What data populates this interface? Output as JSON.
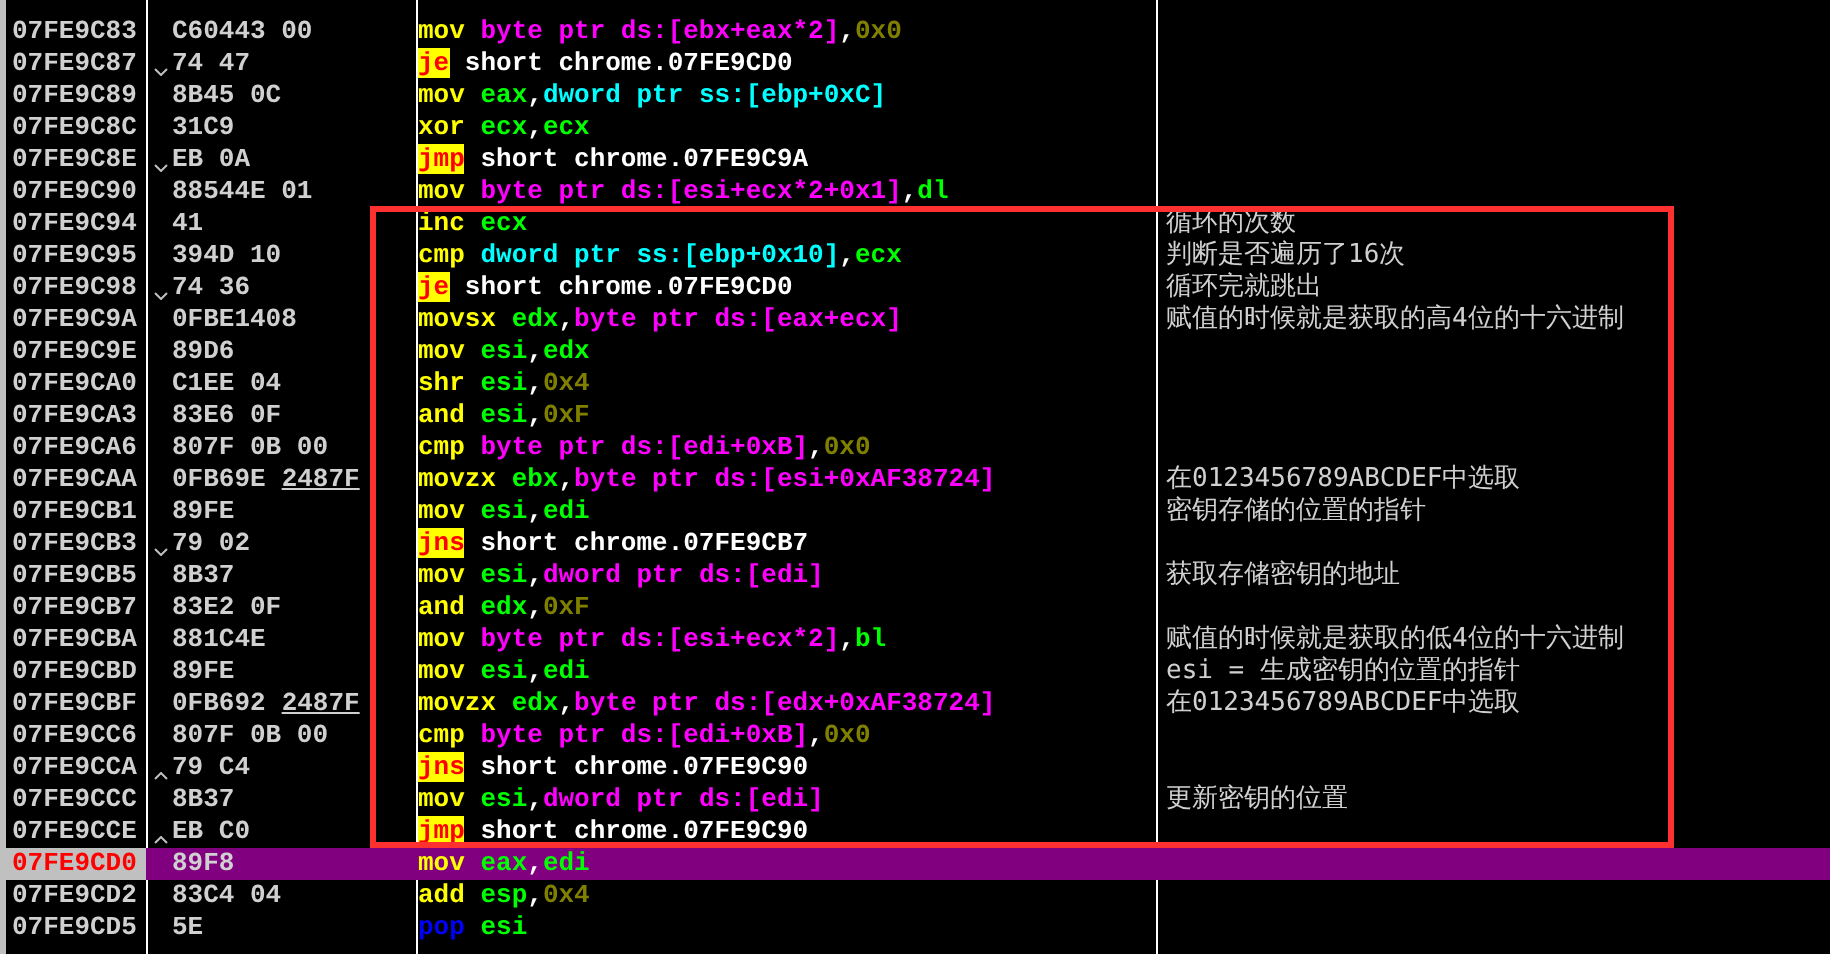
{
  "rows": [
    {
      "address": "07FE9C83",
      "bytes": "C60443 00",
      "mnemonic": {
        "text": "mov",
        "kind": "plain"
      },
      "operands": [
        {
          "text": "byte ptr ds:[ebx+eax*2]",
          "kind": "mem"
        },
        {
          "text": ",",
          "kind": "sep"
        },
        {
          "text": "0x0",
          "kind": "imm"
        }
      ],
      "selected": false
    },
    {
      "address": "07FE9C87",
      "arrow": {
        "kind": "down"
      },
      "bytes": "74 47",
      "mnemonic": {
        "text": "je",
        "kind": "jump"
      },
      "operands": [
        {
          "text": "short chrome.07FE9CD0",
          "kind": "label"
        }
      ],
      "selected": false
    },
    {
      "address": "07FE9C89",
      "bytes": "8B45 0C",
      "mnemonic": {
        "text": "mov",
        "kind": "plain"
      },
      "operands": [
        {
          "text": "eax",
          "kind": "reg"
        },
        {
          "text": ",",
          "kind": "sep"
        },
        {
          "text": "dword ptr ss:[ebp+0xC]",
          "kind": "stackmem"
        }
      ],
      "selected": false
    },
    {
      "address": "07FE9C8C",
      "bytes": "31C9",
      "mnemonic": {
        "text": "xor",
        "kind": "plain"
      },
      "operands": [
        {
          "text": "ecx",
          "kind": "reg"
        },
        {
          "text": ",",
          "kind": "sep"
        },
        {
          "text": "ecx",
          "kind": "reg"
        }
      ],
      "selected": false
    },
    {
      "address": "07FE9C8E",
      "arrow": {
        "kind": "down"
      },
      "bytes": "EB 0A",
      "mnemonic": {
        "text": "jmp",
        "kind": "jump"
      },
      "operands": [
        {
          "text": "short chrome.07FE9C9A",
          "kind": "label"
        }
      ],
      "selected": false
    },
    {
      "address": "07FE9C90",
      "bytes": "88544E 01",
      "mnemonic": {
        "text": "mov",
        "kind": "plain"
      },
      "operands": [
        {
          "text": "byte ptr ds:[esi+ecx*2+0x1]",
          "kind": "mem"
        },
        {
          "text": ",",
          "kind": "sep"
        },
        {
          "text": "dl",
          "kind": "reg"
        }
      ],
      "selected": false
    },
    {
      "address": "07FE9C94",
      "bytes": "41",
      "mnemonic": {
        "text": "inc",
        "kind": "plain"
      },
      "operands": [
        {
          "text": "ecx",
          "kind": "reg"
        }
      ],
      "comment": "循环的次数",
      "selected": false
    },
    {
      "address": "07FE9C95",
      "bytes": "394D 10",
      "mnemonic": {
        "text": "cmp",
        "kind": "plain"
      },
      "operands": [
        {
          "text": "dword ptr ss:[ebp+0x10]",
          "kind": "stackmem"
        },
        {
          "text": ",",
          "kind": "sep"
        },
        {
          "text": "ecx",
          "kind": "reg"
        }
      ],
      "comment": "判断是否遍历了16次",
      "selected": false
    },
    {
      "address": "07FE9C98",
      "arrow": {
        "kind": "down"
      },
      "bytes": "74 36",
      "mnemonic": {
        "text": "je",
        "kind": "jump"
      },
      "operands": [
        {
          "text": "short chrome.07FE9CD0",
          "kind": "label"
        }
      ],
      "comment": "循环完就跳出",
      "selected": false
    },
    {
      "address": "07FE9C9A",
      "bytes": "0FBE1408",
      "mnemonic": {
        "text": "movsx",
        "kind": "plain"
      },
      "operands": [
        {
          "text": "edx",
          "kind": "reg"
        },
        {
          "text": ",",
          "kind": "sep"
        },
        {
          "text": "byte ptr ds:[eax+ecx]",
          "kind": "mem"
        }
      ],
      "comment": "赋值的时候就是获取的高4位的十六进制",
      "selected": false
    },
    {
      "address": "07FE9C9E",
      "bytes": "89D6",
      "mnemonic": {
        "text": "mov",
        "kind": "plain"
      },
      "operands": [
        {
          "text": "esi",
          "kind": "reg"
        },
        {
          "text": ",",
          "kind": "sep"
        },
        {
          "text": "edx",
          "kind": "reg"
        }
      ],
      "selected": false
    },
    {
      "address": "07FE9CA0",
      "bytes": "C1EE 04",
      "mnemonic": {
        "text": "shr",
        "kind": "plain"
      },
      "operands": [
        {
          "text": "esi",
          "kind": "reg"
        },
        {
          "text": ",",
          "kind": "sep"
        },
        {
          "text": "0x4",
          "kind": "imm"
        }
      ],
      "selected": false
    },
    {
      "address": "07FE9CA3",
      "bytes": "83E6 0F",
      "mnemonic": {
        "text": "and",
        "kind": "plain"
      },
      "operands": [
        {
          "text": "esi",
          "kind": "reg"
        },
        {
          "text": ",",
          "kind": "sep"
        },
        {
          "text": "0xF",
          "kind": "imm"
        }
      ],
      "selected": false
    },
    {
      "address": "07FE9CA6",
      "bytes": "807F 0B 00",
      "mnemonic": {
        "text": "cmp",
        "kind": "plain"
      },
      "operands": [
        {
          "text": "byte ptr ds:[edi+0xB]",
          "kind": "mem"
        },
        {
          "text": ",",
          "kind": "sep"
        },
        {
          "text": "0x0",
          "kind": "imm"
        }
      ],
      "selected": false
    },
    {
      "address": "07FE9CAA",
      "bytes": "0FB69E",
      "bytes_ref": "2487F",
      "mnemonic": {
        "text": "movzx",
        "kind": "plain"
      },
      "operands": [
        {
          "text": "ebx",
          "kind": "reg"
        },
        {
          "text": ",",
          "kind": "sep"
        },
        {
          "text": "byte ptr ds:[esi+0xAF38724]",
          "kind": "mem"
        }
      ],
      "comment": "在0123456789ABCDEF中选取",
      "selected": false
    },
    {
      "address": "07FE9CB1",
      "bytes": "89FE",
      "mnemonic": {
        "text": "mov",
        "kind": "plain"
      },
      "operands": [
        {
          "text": "esi",
          "kind": "reg"
        },
        {
          "text": ",",
          "kind": "sep"
        },
        {
          "text": "edi",
          "kind": "reg"
        }
      ],
      "comment": "密钥存储的位置的指针",
      "selected": false
    },
    {
      "address": "07FE9CB3",
      "arrow": {
        "kind": "down"
      },
      "bytes": "79 02",
      "mnemonic": {
        "text": "jns",
        "kind": "jump"
      },
      "operands": [
        {
          "text": "short chrome.07FE9CB7",
          "kind": "label"
        }
      ],
      "selected": false
    },
    {
      "address": "07FE9CB5",
      "bytes": "8B37",
      "mnemonic": {
        "text": "mov",
        "kind": "plain"
      },
      "operands": [
        {
          "text": "esi",
          "kind": "reg"
        },
        {
          "text": ",",
          "kind": "sep"
        },
        {
          "text": "dword ptr ds:[edi]",
          "kind": "mem"
        }
      ],
      "comment": "获取存储密钥的地址",
      "selected": false
    },
    {
      "address": "07FE9CB7",
      "bytes": "83E2 0F",
      "mnemonic": {
        "text": "and",
        "kind": "plain"
      },
      "operands": [
        {
          "text": "edx",
          "kind": "reg"
        },
        {
          "text": ",",
          "kind": "sep"
        },
        {
          "text": "0xF",
          "kind": "imm"
        }
      ],
      "selected": false
    },
    {
      "address": "07FE9CBA",
      "bytes": "881C4E",
      "mnemonic": {
        "text": "mov",
        "kind": "plain"
      },
      "operands": [
        {
          "text": "byte ptr ds:[esi+ecx*2]",
          "kind": "mem"
        },
        {
          "text": ",",
          "kind": "sep"
        },
        {
          "text": "bl",
          "kind": "reg"
        }
      ],
      "comment": "赋值的时候就是获取的低4位的十六进制",
      "selected": false
    },
    {
      "address": "07FE9CBD",
      "bytes": "89FE",
      "mnemonic": {
        "text": "mov",
        "kind": "plain"
      },
      "operands": [
        {
          "text": "esi",
          "kind": "reg"
        },
        {
          "text": ",",
          "kind": "sep"
        },
        {
          "text": "edi",
          "kind": "reg"
        }
      ],
      "comment": "esi = 生成密钥的位置的指针",
      "selected": false
    },
    {
      "address": "07FE9CBF",
      "bytes": "0FB692",
      "bytes_ref": "2487F",
      "mnemonic": {
        "text": "movzx",
        "kind": "plain"
      },
      "operands": [
        {
          "text": "edx",
          "kind": "reg"
        },
        {
          "text": ",",
          "kind": "sep"
        },
        {
          "text": "byte ptr ds:[edx+0xAF38724]",
          "kind": "mem"
        }
      ],
      "comment": "在0123456789ABCDEF中选取",
      "selected": false
    },
    {
      "address": "07FE9CC6",
      "bytes": "807F 0B 00",
      "mnemonic": {
        "text": "cmp",
        "kind": "plain"
      },
      "operands": [
        {
          "text": "byte ptr ds:[edi+0xB]",
          "kind": "mem"
        },
        {
          "text": ",",
          "kind": "sep"
        },
        {
          "text": "0x0",
          "kind": "imm"
        }
      ],
      "selected": false
    },
    {
      "address": "07FE9CCA",
      "arrow": {
        "kind": "up"
      },
      "bytes": "79 C4",
      "mnemonic": {
        "text": "jns",
        "kind": "jump"
      },
      "operands": [
        {
          "text": "short chrome.07FE9C90",
          "kind": "label"
        }
      ],
      "selected": false
    },
    {
      "address": "07FE9CCC",
      "bytes": "8B37",
      "mnemonic": {
        "text": "mov",
        "kind": "plain"
      },
      "operands": [
        {
          "text": "esi",
          "kind": "reg"
        },
        {
          "text": ",",
          "kind": "sep"
        },
        {
          "text": "dword ptr ds:[edi]",
          "kind": "mem"
        }
      ],
      "comment": "更新密钥的位置",
      "selected": false
    },
    {
      "address": "07FE9CCE",
      "arrow": {
        "kind": "up"
      },
      "bytes": "EB C0",
      "mnemonic": {
        "text": "jmp",
        "kind": "jump"
      },
      "operands": [
        {
          "text": "short chrome.07FE9C90",
          "kind": "label"
        }
      ],
      "selected": false
    },
    {
      "address": "07FE9CD0",
      "bytes": "89F8",
      "mnemonic": {
        "text": "mov",
        "kind": "plain"
      },
      "operands": [
        {
          "text": "eax",
          "kind": "reg"
        },
        {
          "text": ",",
          "kind": "sep"
        },
        {
          "text": "edi",
          "kind": "reg"
        }
      ],
      "selected": true
    },
    {
      "address": "07FE9CD2",
      "bytes": "83C4 04",
      "mnemonic": {
        "text": "add",
        "kind": "plain"
      },
      "operands": [
        {
          "text": "esp",
          "kind": "reg"
        },
        {
          "text": ",",
          "kind": "sep"
        },
        {
          "text": "0x4",
          "kind": "imm"
        }
      ],
      "selected": false
    },
    {
      "address": "07FE9CD5",
      "bytes": "5E",
      "mnemonic": {
        "text": "pop",
        "kind": "stack"
      },
      "operands": [
        {
          "text": "esi",
          "kind": "reg"
        }
      ],
      "selected": false
    }
  ]
}
